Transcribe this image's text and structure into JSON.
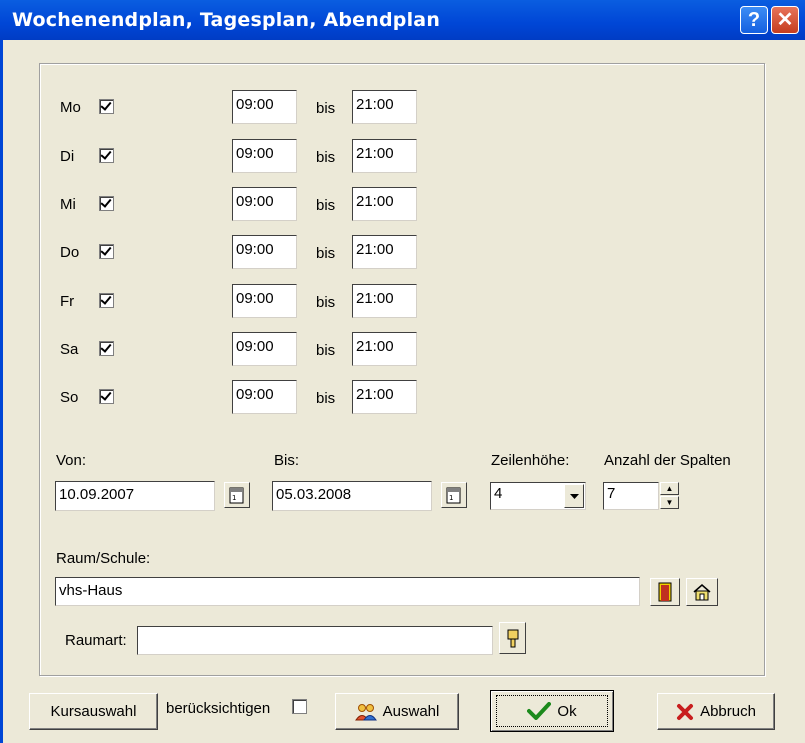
{
  "window": {
    "title": "Wochenendplan, Tagesplan, Abendplan",
    "help_glyph": "?",
    "close_glyph": "✕"
  },
  "days": [
    {
      "label": "Mo",
      "checked": true,
      "from": "09:00",
      "bis": "bis",
      "to": "21:00"
    },
    {
      "label": "Di",
      "checked": true,
      "from": "09:00",
      "bis": "bis",
      "to": "21:00"
    },
    {
      "label": "Mi",
      "checked": true,
      "from": "09:00",
      "bis": "bis",
      "to": "21:00"
    },
    {
      "label": "Do",
      "checked": true,
      "from": "09:00",
      "bis": "bis",
      "to": "21:00"
    },
    {
      "label": "Fr",
      "checked": true,
      "from": "09:00",
      "bis": "bis",
      "to": "21:00"
    },
    {
      "label": "Sa",
      "checked": true,
      "from": "09:00",
      "bis": "bis",
      "to": "21:00"
    },
    {
      "label": "So",
      "checked": true,
      "from": "09:00",
      "bis": "bis",
      "to": "21:00"
    }
  ],
  "range": {
    "von_label": "Von:",
    "von_value": "10.09.2007",
    "bis_label": "Bis:",
    "bis_value": "05.03.2008",
    "zeilenhoehe_label": "Zeilenhöhe:",
    "zeilenhoehe_value": "4",
    "spalten_label": "Anzahl der Spalten",
    "spalten_value": "7"
  },
  "raum": {
    "label": "Raum/Schule:",
    "value": "vhs-Haus"
  },
  "raumart": {
    "label": "Raumart:",
    "value": ""
  },
  "footer": {
    "kursauswahl": "Kursauswahl",
    "beruecksichtigen": "berücksichtigen",
    "auswahl": "Auswahl",
    "ok": "Ok",
    "abbruch": "Abbruch"
  },
  "colors": {
    "titlebar": "#0046d6",
    "dialog_bg": "#ece9d8",
    "ok_check": "#1c8a1c",
    "cancel_x": "#c81e1e"
  }
}
